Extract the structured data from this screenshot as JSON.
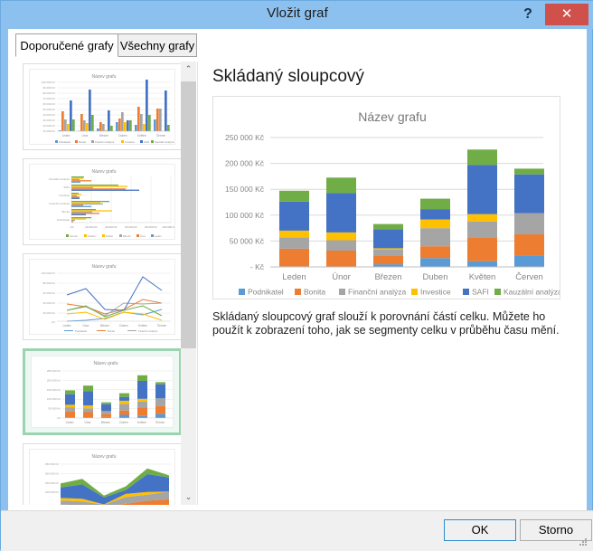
{
  "window": {
    "title": "Vložit graf",
    "help_label": "?",
    "close_label": "✕"
  },
  "tabs": [
    {
      "label": "Doporučené grafy",
      "active": true
    },
    {
      "label": "Všechny grafy",
      "active": false
    }
  ],
  "scrollbar": {
    "up_arrow": "⌃",
    "down_arrow": "⌄"
  },
  "thumbnails": [
    {
      "name": "clustered-column",
      "title": "Název grafu",
      "selected": false
    },
    {
      "name": "clustered-bar",
      "title": "Název grafu",
      "selected": false
    },
    {
      "name": "line",
      "title": "Název grafu",
      "selected": false
    },
    {
      "name": "stacked-column",
      "title": "Název grafu",
      "selected": true
    },
    {
      "name": "stacked-area",
      "title": "Název grafu",
      "selected": false
    }
  ],
  "preview": {
    "heading": "Skládaný sloupcový",
    "description": "Skládaný sloupcový graf slouží k porovnání částí celku. Můžete ho použít k zobrazení toho, jak se segmenty celku v průběhu času mění."
  },
  "footer": {
    "ok_label": "OK",
    "cancel_label": "Storno"
  },
  "colors": {
    "accent_title_bar": "#8cc1ef",
    "close_button": "#d0504b",
    "selection_border": "#9cd3b0",
    "series": [
      "#5B9BD5",
      "#ED7D31",
      "#A5A5A5",
      "#FFC000",
      "#4472C4",
      "#70AD47"
    ]
  },
  "chart_data": {
    "type": "bar",
    "subtype": "stacked-column",
    "title": "Název grafu",
    "xlabel": "",
    "ylabel": "",
    "ylim": [
      0,
      250000
    ],
    "yticks": [
      0,
      50000,
      100000,
      150000,
      200000,
      250000
    ],
    "ytick_labels": [
      "-   Kč",
      "50 000 Kč",
      "100 000 Kč",
      "150 000 Kč",
      "200 000 Kč",
      "250 000 Kč"
    ],
    "grid": true,
    "legend_position": "bottom",
    "categories": [
      "Leden",
      "Únor",
      "Březen",
      "Duben",
      "Květen",
      "Červen"
    ],
    "series": [
      {
        "name": "Podnikatel",
        "color": "#5B9BD5",
        "values": [
          1000,
          500,
          5000,
          17000,
          11000,
          22000
        ]
      },
      {
        "name": "Bonita",
        "color": "#ED7D31",
        "values": [
          34000,
          31000,
          16000,
          23000,
          45000,
          41000
        ]
      },
      {
        "name": "Finanční analýza",
        "color": "#A5A5A5",
        "values": [
          22000,
          20000,
          13000,
          35000,
          32000,
          41000
        ]
      },
      {
        "name": "Investice",
        "color": "#FFC000",
        "values": [
          13000,
          15000,
          2000,
          17000,
          14000,
          0
        ]
      },
      {
        "name": "SAFI",
        "color": "#4472C4",
        "values": [
          56000,
          76000,
          37000,
          20000,
          95000,
          75000
        ]
      },
      {
        "name": "Kauzální analýza",
        "color": "#70AD47",
        "values": [
          21000,
          30000,
          10000,
          20000,
          30000,
          11000
        ]
      }
    ]
  }
}
